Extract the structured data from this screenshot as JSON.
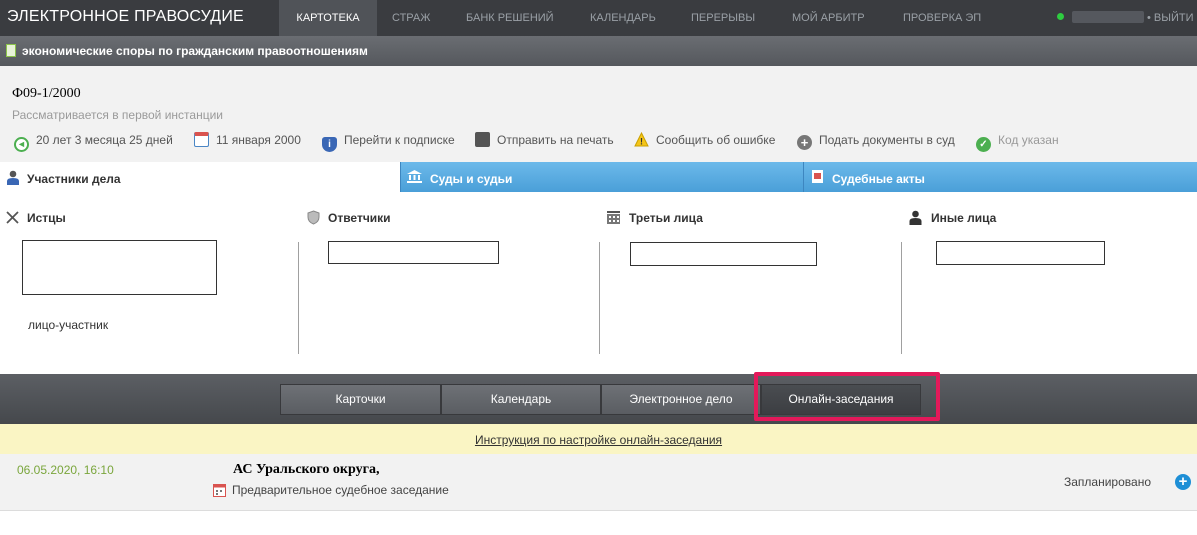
{
  "header": {
    "brand": "ЭЛЕКТРОННОЕ ПРАВОСУДИЕ",
    "nav": [
      "КАРТОТЕКА",
      "СТРАЖ",
      "БАНК РЕШЕНИЙ",
      "КАЛЕНДАРЬ",
      "ПЕРЕРЫВЫ",
      "МОЙ АРБИТР",
      "ПРОВЕРКА ЭП"
    ],
    "active_nav": "КАРТОТЕКА",
    "logout": "• ВЫЙТИ",
    "online_color": "#2ecc40"
  },
  "category": {
    "text": "экономические споры по гражданским правоотношениям",
    "icon": "document-icon"
  },
  "case": {
    "number": "Ф09-1/2000",
    "status": "Рассматривается в первой инстанции",
    "tools": {
      "duration": "20 лет 3 месяца 25 дней",
      "date": "11 января 2000",
      "subscribe": "Перейти к подписке",
      "print": "Отправить на печать",
      "report": "Сообщить об ошибке",
      "submit": "Подать документы в суд",
      "code": "Код указан"
    }
  },
  "tabs": {
    "participants": "Участники дела",
    "courts": "Суды и судьи",
    "acts": "Судебные акты"
  },
  "parties": {
    "plaintiffs": "Истцы",
    "defendants": "Ответчики",
    "third": "Третьи лица",
    "others": "Иные лица",
    "plaintiff_note": "лицо-участник"
  },
  "actions": {
    "cards": "Карточки",
    "calendar": "Календарь",
    "edelo": "Электронное дело",
    "online": "Онлайн-заседания",
    "highlight_color": "#e3195a"
  },
  "instruction_link": "Инструкция по настройке онлайн-заседания",
  "session": {
    "datetime": "06.05.2020, 16:10",
    "court": "АС Уральского округа,",
    "type": "Предварительное судебное заседание",
    "status": "Запланировано"
  }
}
